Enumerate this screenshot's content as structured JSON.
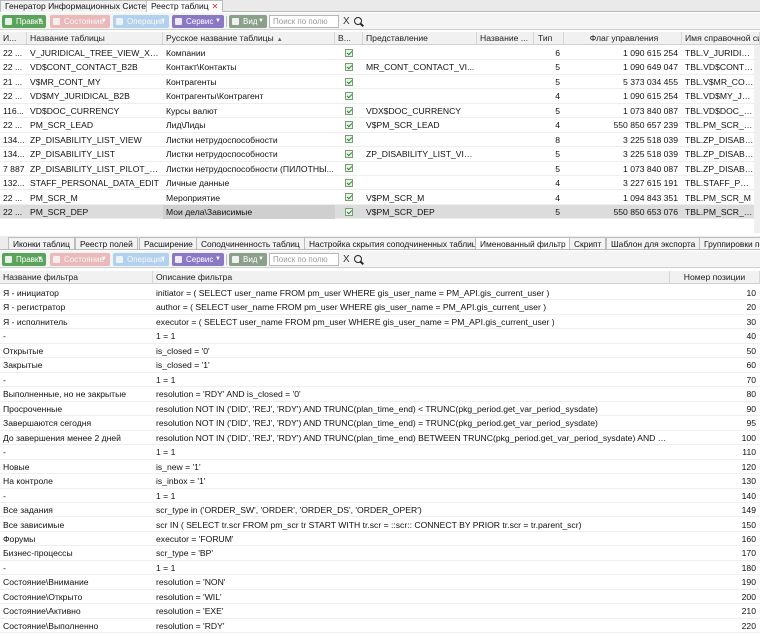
{
  "window_tabs": [
    {
      "label": "Генератор Информационных Систем",
      "active": false
    },
    {
      "label": "Реестр таблиц",
      "active": true
    }
  ],
  "close_glyph": "✕",
  "toolbar": {
    "edit_label": "Правка",
    "state_label": "Состояние",
    "operations_label": "Операции",
    "service_label": "Сервис",
    "view_label": "Вид",
    "search_placeholder": "Поиск по полю",
    "clear_label": "X"
  },
  "top_grid": {
    "columns": [
      "И...",
      "Название таблицы",
      "Русское название таблицы",
      "В...",
      "Представление",
      "Название ...",
      "Тип",
      "Флаг управления",
      "Имя справочной си"
    ],
    "sort_indicator": "▲",
    "rows": [
      {
        "id": "22 ...",
        "name": "V_JURIDICAL_TREE_VIEW_X_B...",
        "rus": "Компании",
        "v": true,
        "view": "",
        "vname": "",
        "type": "6",
        "flag": "1 090 615 254",
        "ref": "TBL.V_JURIDICAL_T"
      },
      {
        "id": "22 ...",
        "name": "VD$CONT_CONTACT_B2B",
        "rus": "Контакт\\Контакты",
        "v": true,
        "view": "MR_CONT_CONTACT_VI...",
        "vname": "",
        "type": "5",
        "flag": "1 090 649 047",
        "ref": "TBL.VD$CONT_CONT"
      },
      {
        "id": "21 ...",
        "name": "V$MR_CONT_MY",
        "rus": "Контрагенты",
        "v": true,
        "view": "",
        "vname": "",
        "type": "5",
        "flag": "5 373 034 455",
        "ref": "TBL.V$MR_CONT_M"
      },
      {
        "id": "22 ...",
        "name": "VD$MY_JURIDICAL_B2B",
        "rus": "Контрагенты\\Контрагент",
        "v": true,
        "view": "",
        "vname": "",
        "type": "4",
        "flag": "1 090 615 254",
        "ref": "TBL.VD$MY_JURIDI"
      },
      {
        "id": "116...",
        "name": "VD$DOC_CURRENCY",
        "rus": "Курсы валют",
        "v": true,
        "view": "VDX$DOC_CURRENCY",
        "vname": "",
        "type": "5",
        "flag": "1 073 840 087",
        "ref": "TBL.VD$DOC_CURR"
      },
      {
        "id": "22 ...",
        "name": "PM_SCR_LEAD",
        "rus": "Лид\\Лиды",
        "v": true,
        "view": "V$PM_SCR_LEAD",
        "vname": "",
        "type": "4",
        "flag": "550 850 657 239",
        "ref": "TBL.PM_SCR_LEAD"
      },
      {
        "id": "134...",
        "name": "ZP_DISABILITY_LIST_VIEW",
        "rus": "Листки нетрудоспособности",
        "v": true,
        "view": "",
        "vname": "",
        "type": "8",
        "flag": "3 225 518 039",
        "ref": "TBL.ZP_DISABILITY"
      },
      {
        "id": "134...",
        "name": "ZP_DISABILITY_LIST",
        "rus": "Листки нетрудоспособности",
        "v": true,
        "view": "ZP_DISABILITY_LIST_VIEW",
        "vname": "",
        "type": "5",
        "flag": "3 225 518 039",
        "ref": "TBL.ZP_DISABILITY"
      },
      {
        "id": "7 887",
        "name": "ZP_DISABILITY_LIST_PILOT_VI...",
        "rus": "Листки нетрудоспособности (ПИЛОТНЫ...",
        "v": true,
        "view": "",
        "vname": "",
        "type": "5",
        "flag": "1 073 840 087",
        "ref": "TBL.ZP_DISABILITY"
      },
      {
        "id": "132...",
        "name": "STAFF_PERSONAL_DATA_EDIT",
        "rus": "Личные данные",
        "v": true,
        "view": "",
        "vname": "",
        "type": "4",
        "flag": "3 227 615 191",
        "ref": "TBL.STAFF_PERSO"
      },
      {
        "id": "22 ...",
        "name": "PM_SCR_M",
        "rus": "Мероприятие",
        "v": true,
        "view": "V$PM_SCR_M",
        "vname": "",
        "type": "4",
        "flag": "1 094 843 351",
        "ref": "TBL.PM_SCR_M"
      },
      {
        "id": "22 ...",
        "name": "PM_SCR_DEP",
        "rus": "Мои дела\\Зависимые",
        "v": true,
        "view": "V$PM_SCR_DEP",
        "vname": "",
        "type": "5",
        "flag": "550 850 653 076",
        "ref": "TBL.PM_SCR_DEP",
        "selected": true
      }
    ]
  },
  "sub_tabs": [
    {
      "label": "Иконки таблиц",
      "active": false
    },
    {
      "label": "Реестр полей",
      "active": false
    },
    {
      "label": "Расширение",
      "active": false
    },
    {
      "label": "Соподчиненность таблиц",
      "active": false
    },
    {
      "label": "Настройка скрытия соподчиненных таблиц",
      "active": false
    },
    {
      "label": "Именованный фильтр",
      "active": true
    },
    {
      "label": "Скрипт",
      "active": false
    },
    {
      "label": "Шаблон для экспорта",
      "active": false
    },
    {
      "label": "Группировки по-у",
      "active": false
    }
  ],
  "filter_grid": {
    "columns": [
      "Название фильтра",
      "Описание фильтра",
      "Номер позиции"
    ],
    "rows": [
      {
        "name": "Я - инициатор",
        "desc": "initiator = ( SELECT user_name FROM pm_user WHERE gis_user_name = PM_API.gis_current_user )",
        "pos": "10"
      },
      {
        "name": "Я - регистратор",
        "desc": "author = ( SELECT user_name FROM pm_user WHERE gis_user_name = PM_API.gis_current_user )",
        "pos": "20"
      },
      {
        "name": "Я - исполнитель",
        "desc": "executor = ( SELECT user_name FROM pm_user WHERE gis_user_name = PM_API.gis_current_user )",
        "pos": "30"
      },
      {
        "name": "-",
        "desc": "1 = 1",
        "pos": "40"
      },
      {
        "name": "Открытые",
        "desc": "is_closed = '0'",
        "pos": "50"
      },
      {
        "name": "Закрытые",
        "desc": "is_closed = '1'",
        "pos": "60"
      },
      {
        "name": "-",
        "desc": "1 = 1",
        "pos": "70"
      },
      {
        "name": "Выполненные, но не закрытые",
        "desc": "resolution = 'RDY' AND is_closed = '0'",
        "pos": "80"
      },
      {
        "name": "Просроченные",
        "desc": "resolution NOT IN ('DID', 'REJ', 'RDY') AND TRUNC(plan_time_end) < TRUNC(pkg_period.get_var_period_sysdate)",
        "pos": "90"
      },
      {
        "name": "Завершаются сегодня",
        "desc": "resolution NOT IN ('DID', 'REJ', 'RDY') AND TRUNC(plan_time_end) = TRUNC(pkg_period.get_var_period_sysdate)",
        "pos": "95"
      },
      {
        "name": "До завершения менее 2 дней",
        "desc": "resolution NOT IN ('DID', 'REJ', 'RDY') AND TRUNC(plan_time_end) BETWEEN TRUNC(pkg_period.get_var_period_sysdate) AND TRUNC...",
        "pos": "100"
      },
      {
        "name": "-",
        "desc": "1 = 1",
        "pos": "110"
      },
      {
        "name": "Новые",
        "desc": "is_new = '1'",
        "pos": "120"
      },
      {
        "name": "На контроле",
        "desc": "is_inbox = '1'",
        "pos": "130"
      },
      {
        "name": "-",
        "desc": "1 = 1",
        "pos": "140"
      },
      {
        "name": "Все задания",
        "desc": "scr_type in ('ORDER_SW', 'ORDER', 'ORDER_DS', 'ORDER_OPER')",
        "pos": "149"
      },
      {
        "name": "Все зависимые",
        "desc": "scr IN ( SELECT tr.scr FROM pm_scr tr START WITH tr.scr = ::scr:: CONNECT BY PRIOR tr.scr = tr.parent_scr)",
        "pos": "150"
      },
      {
        "name": "Форумы",
        "desc": "executor = 'FORUM'",
        "pos": "160"
      },
      {
        "name": "Бизнес-процессы",
        "desc": "scr_type = 'BP'",
        "pos": "170"
      },
      {
        "name": "-",
        "desc": "1 = 1",
        "pos": "180"
      },
      {
        "name": "Состояние\\Внимание",
        "desc": "resolution = 'NON'",
        "pos": "190"
      },
      {
        "name": "Состояние\\Открыто",
        "desc": "resolution = 'WIL'",
        "pos": "200"
      },
      {
        "name": "Состояние\\Активно",
        "desc": "resolution = 'EXE'",
        "pos": "210"
      },
      {
        "name": "Состояние\\Выполненно",
        "desc": "resolution = 'RDY'",
        "pos": "220"
      }
    ]
  }
}
